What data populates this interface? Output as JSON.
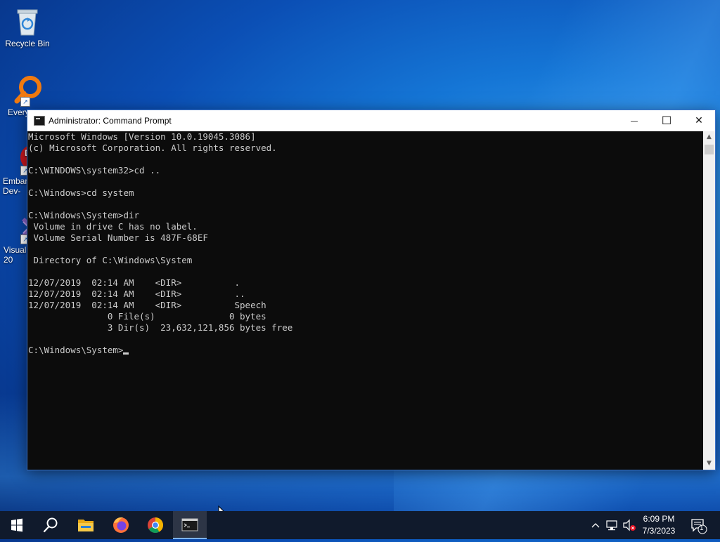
{
  "desktop": {
    "icons": [
      {
        "label": "Recycle Bin"
      },
      {
        "label": "Every"
      },
      {
        "label": "Embar\nDev-"
      },
      {
        "label": "Visual\n20"
      }
    ]
  },
  "window": {
    "title": "Administrator: Command Prompt",
    "minimize_symbol": "—",
    "maximize_symbol": "☐",
    "close_symbol": "✕",
    "console_lines": [
      "Microsoft Windows [Version 10.0.19045.3086]",
      "(c) Microsoft Corporation. All rights reserved.",
      "",
      "C:\\WINDOWS\\system32>cd ..",
      "",
      "C:\\Windows>cd system",
      "",
      "C:\\Windows\\System>dir",
      " Volume in drive C has no label.",
      " Volume Serial Number is 487F-68EF",
      "",
      " Directory of C:\\Windows\\System",
      "",
      "12/07/2019  02:14 AM    <DIR>          .",
      "12/07/2019  02:14 AM    <DIR>          ..",
      "12/07/2019  02:14 AM    <DIR>          Speech",
      "               0 File(s)              0 bytes",
      "               3 Dir(s)  23,632,121,856 bytes free",
      ""
    ],
    "prompt": "C:\\Windows\\System>"
  },
  "taskbar": {
    "items": [
      {
        "icon": "windows-start-icon"
      },
      {
        "icon": "search-icon"
      },
      {
        "icon": "file-explorer-icon"
      },
      {
        "icon": "firefox-icon"
      },
      {
        "icon": "chrome-icon"
      },
      {
        "icon": "command-prompt-icon"
      }
    ],
    "tray": {
      "time": "6:09 PM",
      "date": "7/3/2023",
      "notification_count": "1"
    }
  },
  "colors": {
    "console_bg": "#0c0c0c",
    "console_fg": "#cccccc",
    "taskbar_bg": "#101a2c",
    "accent": "#0078d7"
  }
}
